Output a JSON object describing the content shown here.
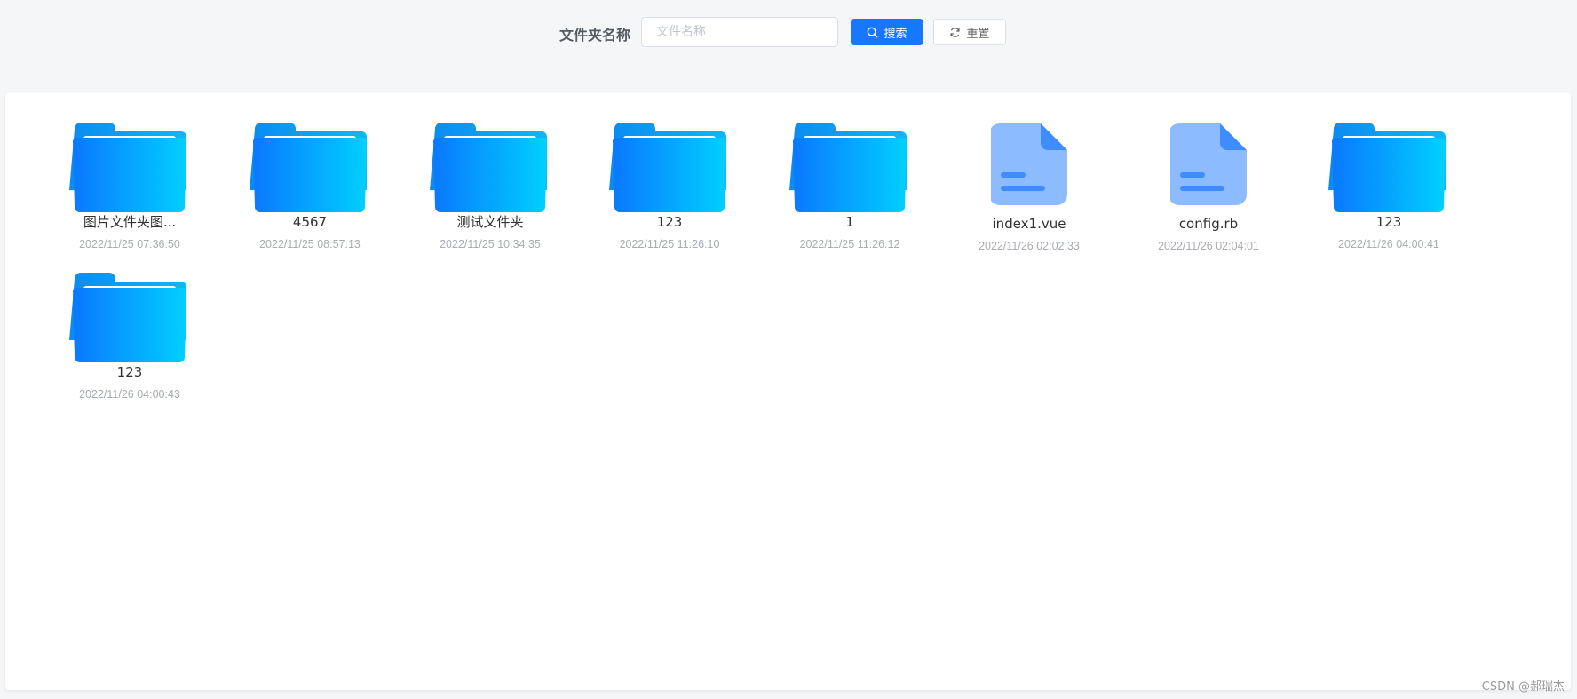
{
  "search": {
    "label": "文件夹名称",
    "placeholder": "文件名称",
    "value": "",
    "search_button_label": "搜索",
    "reset_button_label": "重置"
  },
  "colors": {
    "primary": "#1677ff",
    "folder_gradient_start": "#0a7cff",
    "folder_gradient_end": "#00cfff",
    "file_icon": "#8cbcff"
  },
  "items": [
    {
      "type": "folder",
      "icon": "folder-icon",
      "name": "图片文件夹图...",
      "time": "2022/11/25 07:36:50"
    },
    {
      "type": "folder",
      "icon": "folder-icon",
      "name": "4567",
      "time": "2022/11/25 08:57:13"
    },
    {
      "type": "folder",
      "icon": "folder-icon",
      "name": "测试文件夹",
      "time": "2022/11/25 10:34:35"
    },
    {
      "type": "folder",
      "icon": "folder-icon",
      "name": "123",
      "time": "2022/11/25 11:26:10"
    },
    {
      "type": "folder",
      "icon": "folder-icon",
      "name": "1",
      "time": "2022/11/25 11:26:12"
    },
    {
      "type": "file",
      "icon": "file-icon",
      "name": "index1.vue",
      "time": "2022/11/26 02:02:33"
    },
    {
      "type": "file",
      "icon": "file-icon",
      "name": "config.rb",
      "time": "2022/11/26 02:04:01"
    },
    {
      "type": "folder",
      "icon": "folder-icon",
      "name": "123",
      "time": "2022/11/26 04:00:41"
    },
    {
      "type": "folder",
      "icon": "folder-icon",
      "name": "123",
      "time": "2022/11/26 04:00:43"
    }
  ],
  "watermark": "CSDN @郝瑞杰"
}
